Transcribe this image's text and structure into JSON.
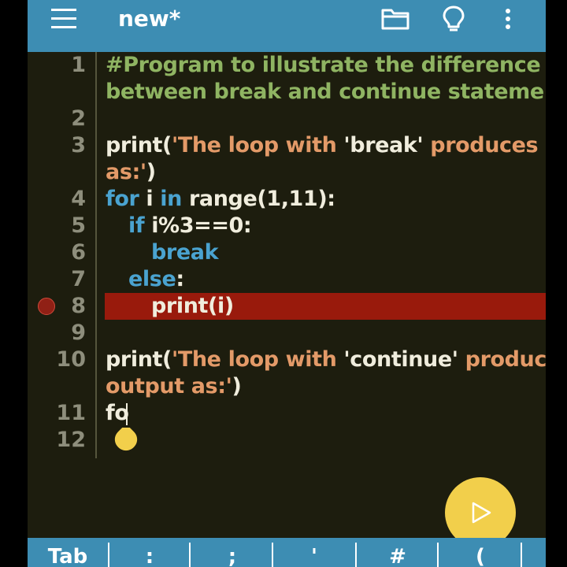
{
  "app": {
    "title": "new*",
    "icons": [
      "menu-icon",
      "folder-icon",
      "lightbulb-icon",
      "more-vert-icon",
      "play-icon"
    ],
    "colors": {
      "toolbar": "#3d8db3",
      "editor_bg": "#1d1d0e",
      "comment": "#8fb462",
      "string": "#e39a68",
      "keyword": "#4aa3d0",
      "text": "#f0eddd",
      "line_number": "#8e8e7c",
      "breakpoint_line": "#991a0c",
      "fab": "#f2cf4b"
    }
  },
  "editor": {
    "line_numbers": [
      "1",
      "2",
      "3",
      "4",
      "5",
      "6",
      "7",
      "8",
      "9",
      "10",
      "11",
      "12"
    ],
    "code": {
      "l1a": "#Program to illustrate the difference",
      "l1b": "between break and continue statements.",
      "l3a_print": "print(",
      "l3a_str": "'The loop with ",
      "l3a_break": "'break'",
      "l3a_str2": " produces output",
      "l3b_str": "as:'",
      "l3b_close": ")",
      "l4_for": "for",
      "l4_i": " i ",
      "l4_in": "in",
      "l4_rest": " range(1,11):",
      "l5_if": "if",
      "l5_rest": " i%3==0:",
      "l6_break": "break",
      "l7_else": "else",
      "l7_colon": ":",
      "l8": "print(i)",
      "l10a_print": "print(",
      "l10a_str": "'The loop with ",
      "l10a_continue": "'continue'",
      "l10a_str2": " produces",
      "l10b_str": "output as:'",
      "l10b_close": ")",
      "l11": "fo"
    },
    "breakpoint_line": "8"
  },
  "keybar": {
    "keys": [
      "Tab",
      ":",
      ";",
      "'",
      "#",
      "("
    ]
  }
}
